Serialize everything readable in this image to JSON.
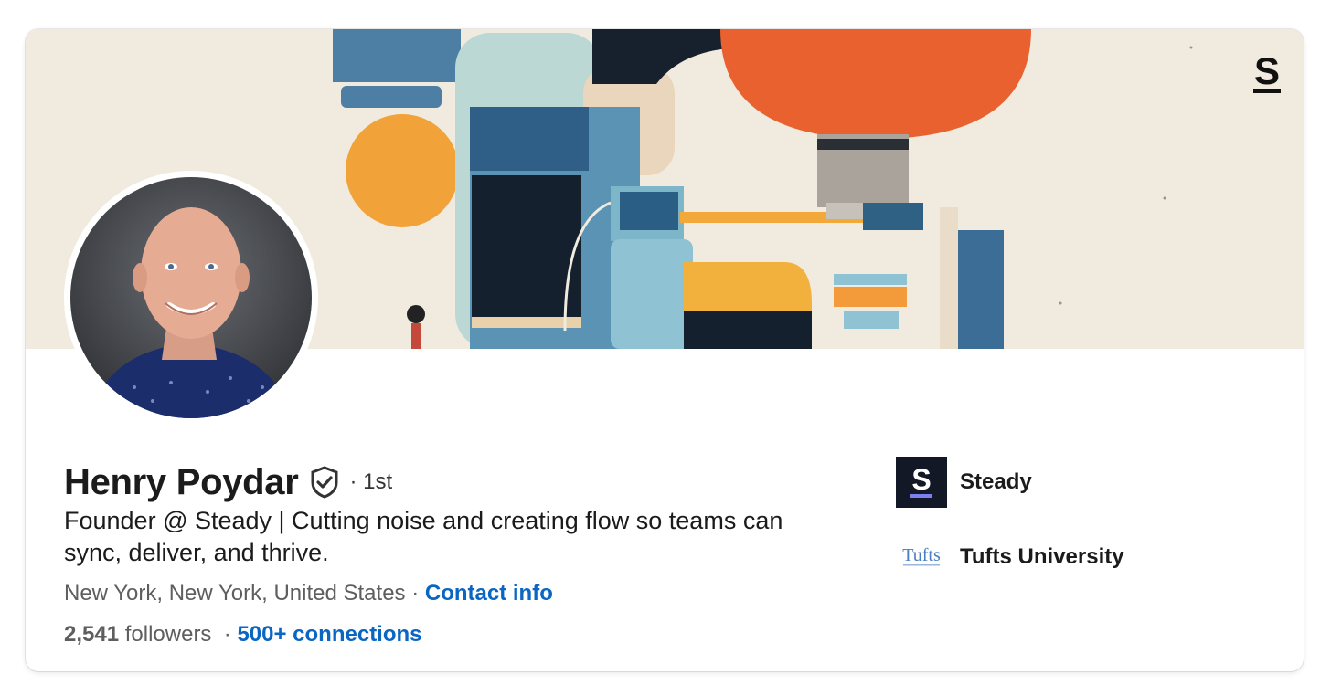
{
  "profile": {
    "name": "Henry Poydar",
    "degree": "· 1st",
    "headline": "Founder @ Steady | Cutting noise and creating flow so teams can sync, deliver, and thrive.",
    "location": "New York, New York, United States",
    "location_separator": " · ",
    "contact_info_label": "Contact info",
    "followers_count": "2,541",
    "followers_label": " followers",
    "stats_separator": "  · ",
    "connections_label": "500+ connections"
  },
  "organizations": [
    {
      "name": "Steady",
      "logo_letter": "S",
      "icon": "steady-logo-icon"
    },
    {
      "name": "Tufts University",
      "logo_text": "Tufts",
      "icon": "tufts-logo-icon"
    }
  ],
  "banner": {
    "brand_letter": "S"
  },
  "colors": {
    "link": "#0a66c2",
    "banner_bg": "#f1ebdf",
    "accent_orange": "#e8612e",
    "accent_yellow": "#f1a33a",
    "accent_blue": "#3f6f93",
    "steady_bar": "#7b7ff0"
  }
}
